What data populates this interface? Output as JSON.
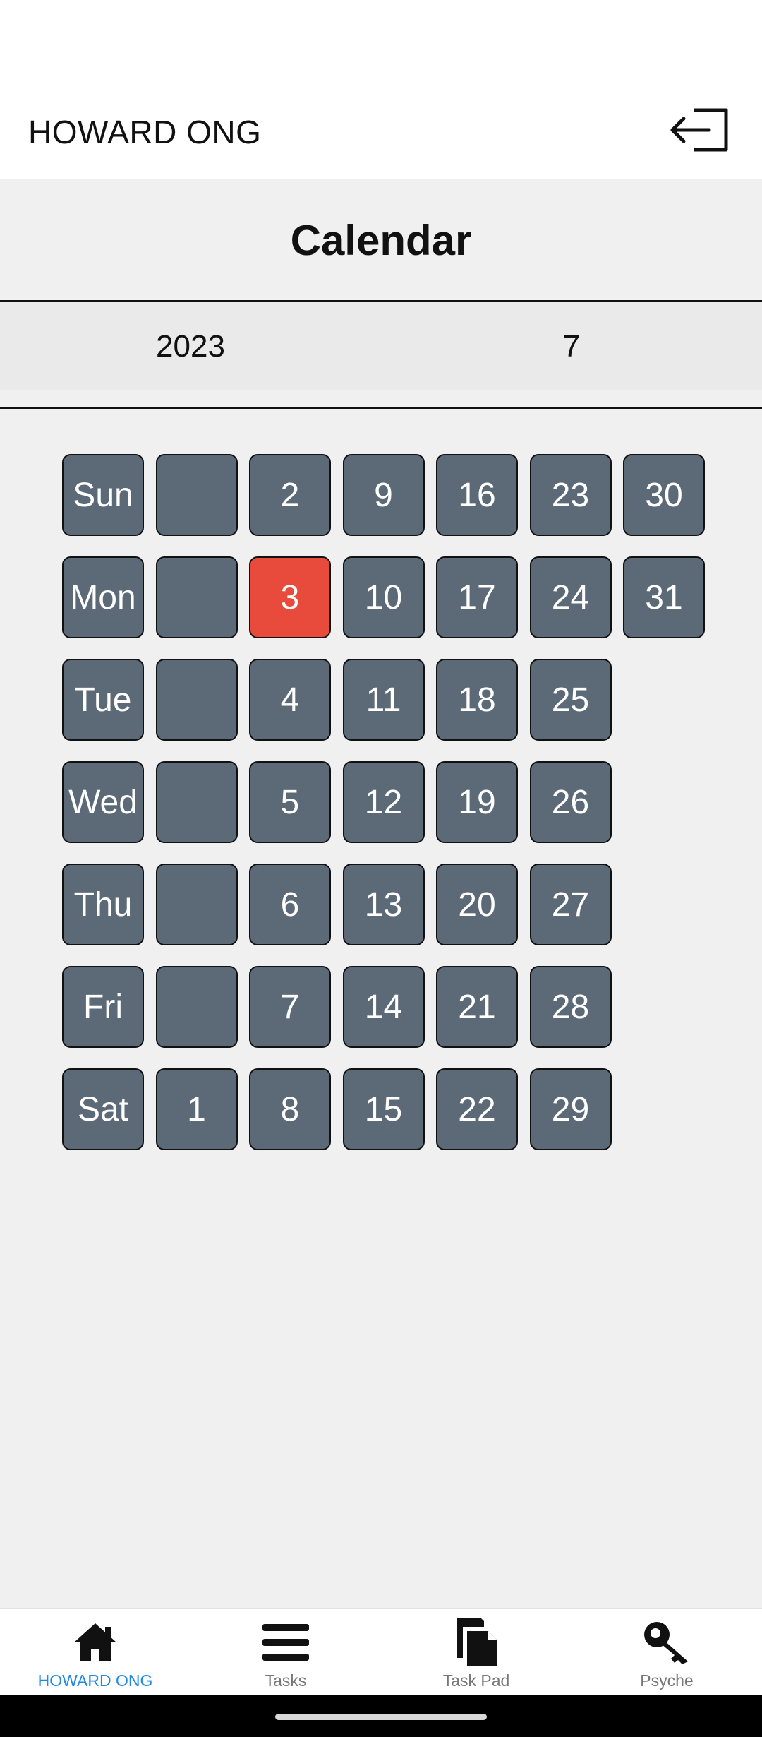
{
  "header": {
    "user_name": "HOWARD ONG"
  },
  "page": {
    "title": "Calendar",
    "year": "2023",
    "month": "7"
  },
  "calendar": {
    "rows": [
      {
        "day": "Sun",
        "dates": [
          "",
          "2",
          "9",
          "16",
          "23",
          "30"
        ]
      },
      {
        "day": "Mon",
        "dates": [
          "",
          "3",
          "10",
          "17",
          "24",
          "31"
        ]
      },
      {
        "day": "Tue",
        "dates": [
          "",
          "4",
          "11",
          "18",
          "25"
        ]
      },
      {
        "day": "Wed",
        "dates": [
          "",
          "5",
          "12",
          "19",
          "26"
        ]
      },
      {
        "day": "Thu",
        "dates": [
          "",
          "6",
          "13",
          "20",
          "27"
        ]
      },
      {
        "day": "Fri",
        "dates": [
          "",
          "7",
          "14",
          "21",
          "28"
        ]
      },
      {
        "day": "Sat",
        "dates": [
          "1",
          "8",
          "15",
          "22",
          "29"
        ]
      }
    ],
    "highlighted_date": "3",
    "colors": {
      "cell": "#5c6a78",
      "highlight": "#e84a3c"
    }
  },
  "nav": {
    "items": [
      {
        "label": "HOWARD ONG",
        "icon": "home-icon",
        "active": true
      },
      {
        "label": "Tasks",
        "icon": "menu-icon",
        "active": false
      },
      {
        "label": "Task Pad",
        "icon": "pages-icon",
        "active": false
      },
      {
        "label": "Psyche",
        "icon": "key-icon",
        "active": false
      }
    ],
    "active_color": "#1e88e5"
  }
}
